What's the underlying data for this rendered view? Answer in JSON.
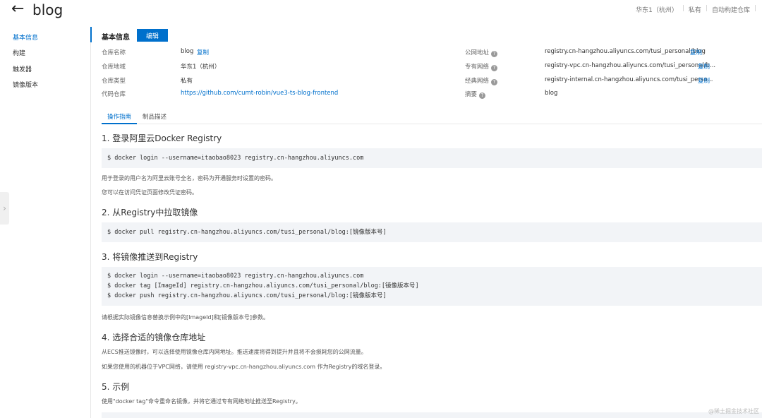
{
  "header": {
    "back_icon": "arrow-left-icon",
    "title": "blog",
    "region": "华东1（杭州）",
    "visibility": "私有",
    "auto_build": "自动构建仓库"
  },
  "sidebar": {
    "items": [
      "基本信息",
      "构建",
      "触发器",
      "镜像版本"
    ]
  },
  "basic_info": {
    "title": "基本信息",
    "edit_label": "编辑",
    "copy_label": "复制",
    "left": [
      {
        "label": "仓库名称",
        "value": "blog"
      },
      {
        "label": "仓库地域",
        "value": "华东1（杭州）"
      },
      {
        "label": "仓库类型",
        "value": "私有"
      },
      {
        "label": "代码仓库",
        "value": "https://github.com/cumt-robin/vue3-ts-blog-frontend"
      }
    ],
    "right": [
      {
        "label": "公网地址",
        "value": "registry.cn-hangzhou.aliyuncs.com/tusi_personal/blog"
      },
      {
        "label": "专有网络",
        "value": "registry-vpc.cn-hangzhou.aliyuncs.com/tusi_personal/b..."
      },
      {
        "label": "经典网络",
        "value": "registry-internal.cn-hangzhou.aliyuncs.com/tusi_perso..."
      },
      {
        "label": "摘要",
        "value": "blog"
      }
    ]
  },
  "tabs": [
    "操作指南",
    "制品描述"
  ],
  "guide": {
    "s1_title": "1. 登录阿里云Docker Registry",
    "s1_code": "$ docker login --username=itaobao8023 registry.cn-hangzhou.aliyuncs.com",
    "s1_p1": "用于登录的用户名为阿里云账号全名，密码为开通服务时设置的密码。",
    "s1_p2": "您可以在访问凭证页面修改凭证密码。",
    "s2_title": "2. 从Registry中拉取镜像",
    "s2_code": "$ docker pull registry.cn-hangzhou.aliyuncs.com/tusi_personal/blog:[镜像版本号]",
    "s3_title": "3. 将镜像推送到Registry",
    "s3_code": [
      "$ docker login --username=itaobao8023 registry.cn-hangzhou.aliyuncs.com",
      "$ docker tag [ImageId] registry.cn-hangzhou.aliyuncs.com/tusi_personal/blog:[镜像版本号]",
      "$ docker push registry.cn-hangzhou.aliyuncs.com/tusi_personal/blog:[镜像版本号]"
    ],
    "s3_p1": "请根据实际镜像信息替换示例中的[ImageId]和[镜像版本号]参数。",
    "s4_title": "4. 选择合适的镜像仓库地址",
    "s4_p1": "从ECS推送镜像时，可以选择使用镜像仓库内网地址。推送速度将得到提升并且将不会损耗您的公网流量。",
    "s4_p2": "如果您使用的机器位于VPC网络，请使用 registry-vpc.cn-hangzhou.aliyuncs.com 作为Registry的域名登录。",
    "s5_title": "5. 示例",
    "s5_p1": "使用\"docker tag\"命令重命名镜像，并将它通过专有网络地址推送至Registry。"
  },
  "watermark": "@稀土掘金技术社区"
}
